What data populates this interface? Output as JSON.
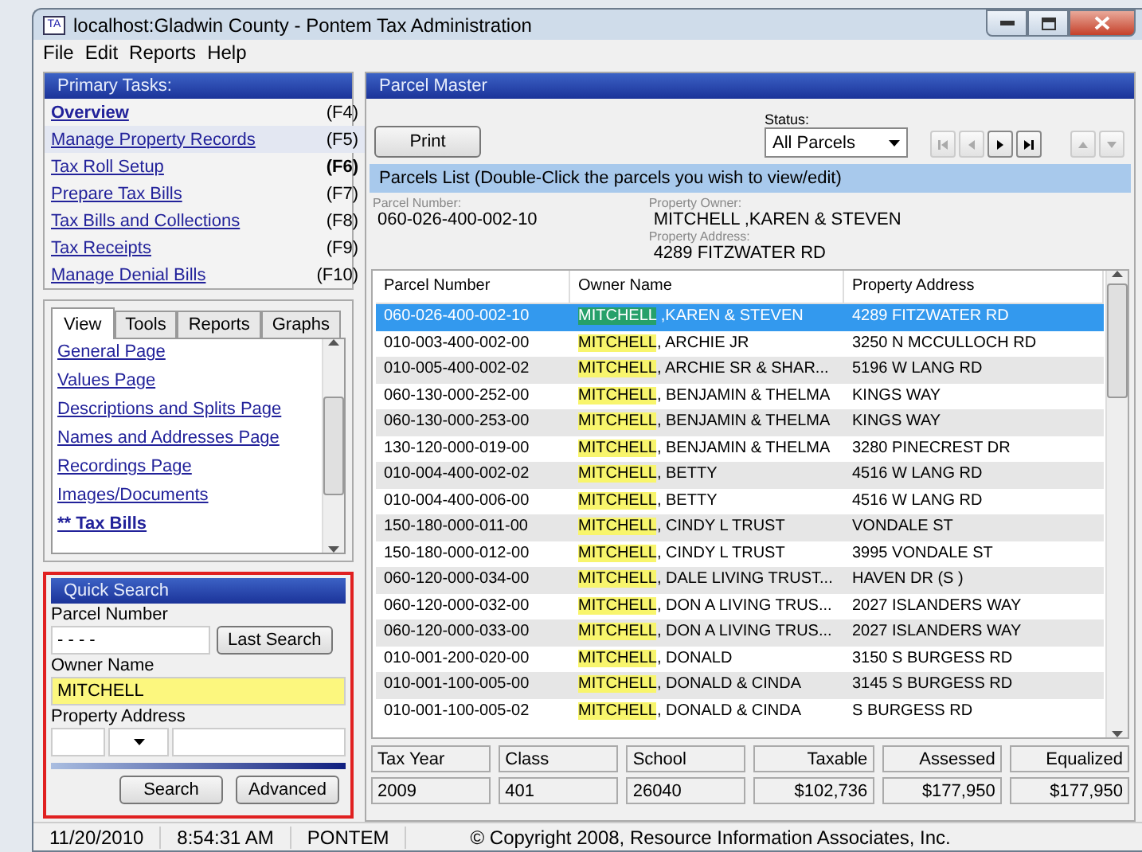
{
  "window": {
    "title": "localhost:Gladwin County - Pontem Tax Administration",
    "icon_text": "TA"
  },
  "menu": [
    "File",
    "Edit",
    "Reports",
    "Help"
  ],
  "primary_tasks": {
    "title": "Primary Tasks:",
    "items": [
      {
        "label": "Overview",
        "key": "(F4)",
        "bold": true,
        "key_bold": false,
        "selected": false
      },
      {
        "label": "Manage Property Records",
        "key": "(F5)",
        "bold": false,
        "key_bold": false,
        "selected": true
      },
      {
        "label": "Tax Roll Setup",
        "key": "(F6)",
        "bold": false,
        "key_bold": true,
        "selected": false
      },
      {
        "label": "Prepare Tax Bills",
        "key": "(F7)",
        "bold": false,
        "key_bold": false,
        "selected": false
      },
      {
        "label": "Tax Bills and Collections",
        "key": "(F8)",
        "bold": false,
        "key_bold": false,
        "selected": false
      },
      {
        "label": "Tax Receipts",
        "key": "(F9)",
        "bold": false,
        "key_bold": false,
        "selected": false
      },
      {
        "label": "Manage Denial Bills",
        "key": "(F10)",
        "bold": false,
        "key_bold": false,
        "selected": false
      }
    ]
  },
  "view_tabs": [
    {
      "label": "View",
      "selected": true
    },
    {
      "label": "Tools",
      "selected": false
    },
    {
      "label": "Reports",
      "selected": false
    },
    {
      "label": "Graphs",
      "selected": false
    }
  ],
  "view_pages": [
    {
      "label": "General Page",
      "bold": false
    },
    {
      "label": "Values Page",
      "bold": false
    },
    {
      "label": "Descriptions and Splits Page",
      "bold": false
    },
    {
      "label": "Names and Addresses Page",
      "bold": false
    },
    {
      "label": "Recordings Page",
      "bold": false
    },
    {
      "label": "Images/Documents",
      "bold": false
    },
    {
      "label": "** Tax Bills",
      "bold": true
    }
  ],
  "quick_search": {
    "title": "Quick Search",
    "parcel_label": "Parcel Number",
    "parcel_value": "- - - -",
    "last_search": "Last Search",
    "owner_label": "Owner Name",
    "owner_value": "MITCHELL",
    "address_label": "Property Address",
    "search": "Search",
    "advanced": "Advanced"
  },
  "parcel_master": {
    "title": "Parcel Master",
    "print": "Print",
    "status_label": "Status:",
    "status_value": "All Parcels",
    "nav": [
      {
        "kind": "first",
        "disabled": true
      },
      {
        "kind": "prev",
        "disabled": true
      },
      {
        "kind": "next",
        "disabled": false
      },
      {
        "kind": "last",
        "disabled": false
      }
    ],
    "updown": [
      {
        "kind": "up",
        "disabled": true
      },
      {
        "kind": "down",
        "disabled": true
      }
    ],
    "list_title": "Parcels List (Double-Click the parcels you wish to view/edit)",
    "detail": {
      "parcel_label": "Parcel Number:",
      "parcel_value": "060-026-400-002-10",
      "owner_label": "Property Owner:",
      "owner_value": "MITCHELL ,KAREN & STEVEN",
      "address_label": "Property Address:",
      "address_value": "4289 FITZWATER RD"
    },
    "columns": [
      "Parcel Number",
      "Owner Name",
      "Property Address"
    ],
    "rows": [
      {
        "parcel": "060-026-400-002-10",
        "owner_match": "MITCHELL",
        "owner_rest": " ,KAREN & STEVEN",
        "address": "4289 FITZWATER RD",
        "selected": true
      },
      {
        "parcel": "010-003-400-002-00",
        "owner_match": "MITCHELL",
        "owner_rest": ", ARCHIE JR",
        "address": "3250 N MCCULLOCH RD",
        "selected": false
      },
      {
        "parcel": "010-005-400-002-02",
        "owner_match": "MITCHELL",
        "owner_rest": ", ARCHIE SR & SHAR...",
        "address": "5196 W LANG RD",
        "selected": false
      },
      {
        "parcel": "060-130-000-252-00",
        "owner_match": "MITCHELL",
        "owner_rest": ", BENJAMIN & THELMA",
        "address": "KINGS WAY",
        "selected": false
      },
      {
        "parcel": "060-130-000-253-00",
        "owner_match": "MITCHELL",
        "owner_rest": ", BENJAMIN & THELMA",
        "address": "KINGS WAY",
        "selected": false
      },
      {
        "parcel": "130-120-000-019-00",
        "owner_match": "MITCHELL",
        "owner_rest": ", BENJAMIN & THELMA",
        "address": "3280 PINECREST DR",
        "selected": false
      },
      {
        "parcel": "010-004-400-002-02",
        "owner_match": "MITCHELL",
        "owner_rest": ", BETTY",
        "address": "4516 W LANG RD",
        "selected": false
      },
      {
        "parcel": "010-004-400-006-00",
        "owner_match": "MITCHELL",
        "owner_rest": ", BETTY",
        "address": "4516 W LANG RD",
        "selected": false
      },
      {
        "parcel": "150-180-000-011-00",
        "owner_match": "MITCHELL",
        "owner_rest": ", CINDY L TRUST",
        "address": "VONDALE ST",
        "selected": false
      },
      {
        "parcel": "150-180-000-012-00",
        "owner_match": "MITCHELL",
        "owner_rest": ", CINDY L TRUST",
        "address": "3995 VONDALE ST",
        "selected": false
      },
      {
        "parcel": "060-120-000-034-00",
        "owner_match": "MITCHELL",
        "owner_rest": ", DALE LIVING TRUST...",
        "address": "HAVEN DR (S )",
        "selected": false
      },
      {
        "parcel": "060-120-000-032-00",
        "owner_match": "MITCHELL",
        "owner_rest": ", DON A LIVING TRUS...",
        "address": "2027 ISLANDERS WAY",
        "selected": false
      },
      {
        "parcel": "060-120-000-033-00",
        "owner_match": "MITCHELL",
        "owner_rest": ", DON A LIVING TRUS...",
        "address": "2027 ISLANDERS WAY",
        "selected": false
      },
      {
        "parcel": "010-001-200-020-00",
        "owner_match": "MITCHELL",
        "owner_rest": ", DONALD",
        "address": "3150 S BURGESS RD",
        "selected": false
      },
      {
        "parcel": "010-001-100-005-00",
        "owner_match": "MITCHELL",
        "owner_rest": ", DONALD & CINDA",
        "address": "3145 S BURGESS RD",
        "selected": false
      },
      {
        "parcel": "010-001-100-005-02",
        "owner_match": "MITCHELL",
        "owner_rest": ", DONALD & CINDA",
        "address": "S BURGESS RD",
        "selected": false
      }
    ],
    "summary": [
      {
        "label": "Tax Year",
        "value": "2009",
        "kind": "text"
      },
      {
        "label": "Class",
        "value": "401",
        "kind": "text"
      },
      {
        "label": "School",
        "value": "26040",
        "kind": "text"
      },
      {
        "label": "Taxable",
        "value": "$102,736",
        "kind": "amount"
      },
      {
        "label": "Assessed",
        "value": "$177,950",
        "kind": "amount"
      },
      {
        "label": "Equalized",
        "value": "$177,950",
        "kind": "amount"
      }
    ]
  },
  "status_bar": {
    "date": "11/20/2010",
    "time": "8:54:31 AM",
    "user": "PONTEM",
    "copyright": "© Copyright 2008, Resource Information Associates, Inc."
  }
}
